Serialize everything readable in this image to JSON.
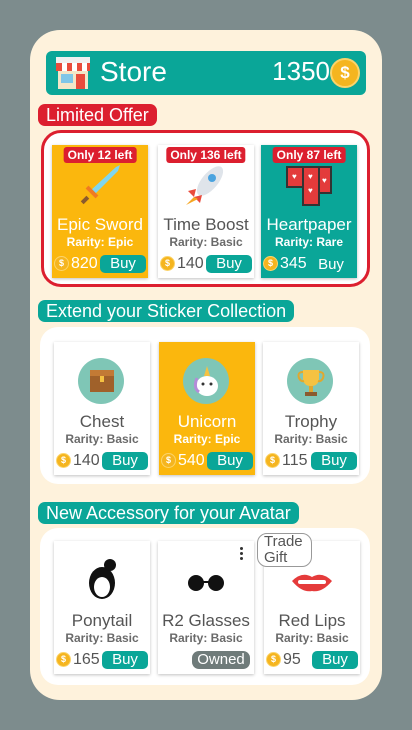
{
  "header": {
    "title": "Store",
    "coins": "1350",
    "coin_symbol": "$"
  },
  "sections": {
    "limited": "Limited Offer",
    "stickers": "Extend your Sticker Collection",
    "accessory": "New Accessory for your Avatar"
  },
  "offers": [
    {
      "badge": "Only 12 left",
      "name": "Epic Sword",
      "rarity": "Rarity: Epic",
      "price": "820",
      "action": "Buy",
      "icon": "sword-icon"
    },
    {
      "badge": "Only 136 left",
      "name": "Time Boost",
      "rarity": "Rarity: Basic",
      "price": "140",
      "action": "Buy",
      "icon": "rocket-icon"
    },
    {
      "badge": "Only 87 left",
      "name": "Heartpaper",
      "rarity": "Rarity: Rare",
      "price": "345",
      "action": "Buy",
      "icon": "heartpaper-icon"
    }
  ],
  "stickers": [
    {
      "name": "Chest",
      "rarity": "Rarity: Basic",
      "price": "140",
      "action": "Buy",
      "icon": "chest-icon"
    },
    {
      "name": "Unicorn",
      "rarity": "Rarity: Epic",
      "price": "540",
      "action": "Buy",
      "icon": "unicorn-icon"
    },
    {
      "name": "Trophy",
      "rarity": "Rarity: Basic",
      "price": "115",
      "action": "Buy",
      "icon": "trophy-icon"
    }
  ],
  "accessories": [
    {
      "name": "Ponytail",
      "rarity": "Rarity: Basic",
      "price": "165",
      "action": "Buy",
      "icon": "ponytail-icon"
    },
    {
      "name": "R2 Glasses",
      "rarity": "Rarity: Basic",
      "status": "Owned",
      "icon": "glasses-icon"
    },
    {
      "name": "Red Lips",
      "rarity": "Rarity: Basic",
      "price": "95",
      "action": "Buy",
      "icon": "lips-icon"
    }
  ],
  "tooltip": {
    "line1": "Trade",
    "line2": "Gift"
  },
  "colors": {
    "teal": "#0aa698",
    "red": "#dc1f2f",
    "yellow": "#fbb70d",
    "panel": "#fef2dc",
    "backdrop": "#7d8c8d"
  }
}
